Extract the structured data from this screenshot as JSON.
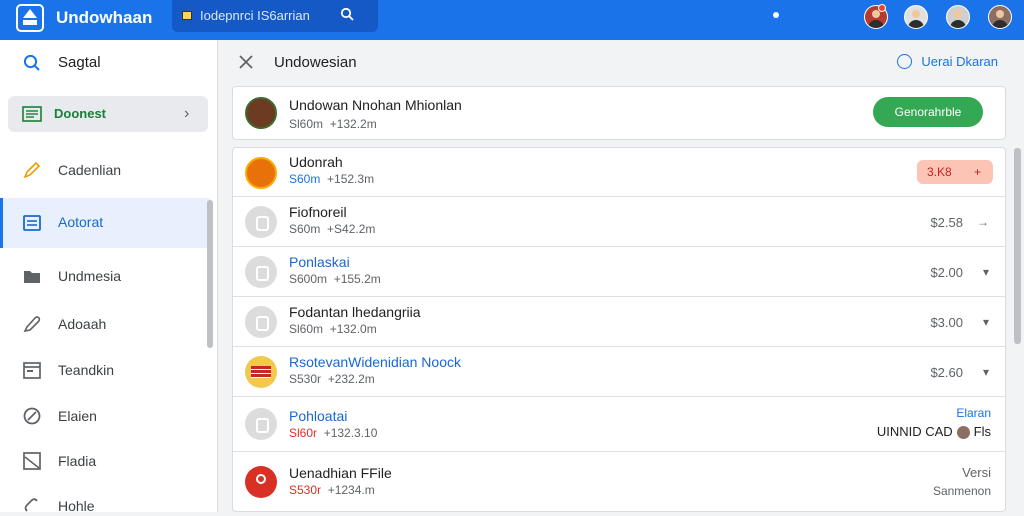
{
  "header": {
    "app_title": "Undowhaan",
    "search_text": "Iodepnrci IS6arrian",
    "logo_icon": "house-logo-icon",
    "search_icon": "search-icon",
    "accent": "#1a73e8"
  },
  "sidebar": {
    "search_label": "Sagtal",
    "directory_label": "Doonest",
    "items": [
      {
        "label": "Cadenlian",
        "icon": "pencil-icon"
      },
      {
        "label": "Aotorat",
        "icon": "document-icon"
      },
      {
        "label": "Undmesia",
        "icon": "folder-icon"
      },
      {
        "label": "Adoaah",
        "icon": "pen-icon"
      },
      {
        "label": "Teandkin",
        "icon": "calendar-icon"
      },
      {
        "label": "Elaien",
        "icon": "circle-slash-icon"
      },
      {
        "label": "Fladia",
        "icon": "image-icon"
      },
      {
        "label": "Hohle",
        "icon": "link-icon"
      }
    ]
  },
  "main": {
    "title": "Undowesian",
    "head_link": "Uerai Dkaran",
    "top_card": {
      "name": "Undowan Nnohan Mhionlan",
      "sub_left": "Sl60m",
      "sub_right": "+132.2m",
      "button": "Genorahrble"
    },
    "rows": [
      {
        "name": "Udonrah",
        "sub_left": "S60m",
        "sub_right": "+152.3m",
        "tag": "3.K8",
        "tag_plus": "+"
      },
      {
        "name": "Fiofnoreil",
        "sub_left": "S60m",
        "sub_right": "+S42.2m",
        "price": "$2.58",
        "arrow": "→"
      },
      {
        "name": "Ponlaskai",
        "sub_left": "S600m",
        "sub_right": "+155.2m",
        "price": "$2.00",
        "arrow": "▾"
      },
      {
        "name": "Fodantan lhedangriia",
        "sub_left": "Sl60m",
        "sub_right": "+132.0m",
        "price": "$3.00",
        "arrow": "▾"
      },
      {
        "name": "RsotevanWidenidian Noock",
        "sub_left": "S530r",
        "sub_right": "+232.2m",
        "price": "$2.60",
        "arrow": "▾"
      },
      {
        "name": "Pohloatai",
        "sub_left": "Sl60r",
        "sub_right": "+132.3.10",
        "right_link": "Elaran",
        "right_text": "UINNID CAD",
        "right_suffix": "Fls"
      },
      {
        "name": "Uenadhian FFile",
        "sub_left": "S530r",
        "sub_right": "+1234.m",
        "right_top": "Versi",
        "right_bottom": "Sanmenon"
      }
    ]
  }
}
